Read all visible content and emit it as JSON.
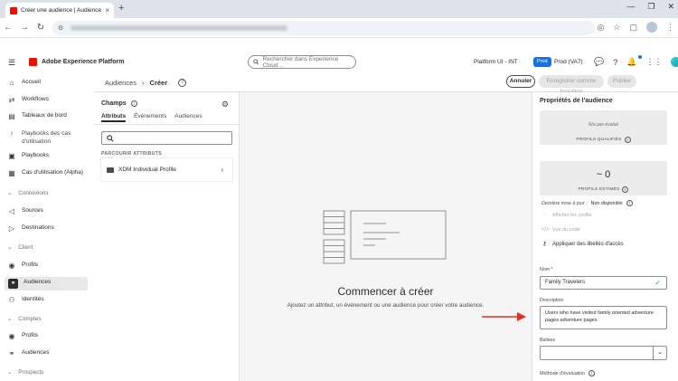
{
  "browser": {
    "tab_title": "Créer une audience | Audiences",
    "new_tab": "+",
    "window_controls": [
      "—",
      "❐",
      "✕"
    ]
  },
  "header": {
    "menu_icon": "hamburger-icon",
    "brand": "Adobe Experience Platform",
    "search_placeholder": "Rechercher dans Experience Cloud ...",
    "sandbox": "Platform UI - INT",
    "prod_badge": "Prod",
    "prod_name": "Prod (VA7)"
  },
  "sidebar": {
    "items": [
      {
        "label": "Accueil",
        "icon": "home-icon"
      },
      {
        "label": "Workflows",
        "icon": "workflow-icon"
      },
      {
        "label": "Tableaux de bord",
        "icon": "dashboard-icon"
      },
      {
        "label": "Playbooks des cas d'utilisation",
        "icon": "chevron-icon"
      },
      {
        "label": "Playbooks",
        "icon": "playbook-icon"
      },
      {
        "label": "Cas d'utilisation (Alpha)",
        "icon": "usecase-icon"
      }
    ],
    "section_connections": "Connexions",
    "connections": [
      {
        "label": "Sources",
        "icon": "sources-icon"
      },
      {
        "label": "Destinations",
        "icon": "destinations-icon"
      }
    ],
    "section_client": "Client",
    "client": [
      {
        "label": "Profils",
        "icon": "profile-icon"
      },
      {
        "label": "Audiences",
        "icon": "audiences-icon"
      },
      {
        "label": "Identités",
        "icon": "identity-icon"
      }
    ],
    "section_accounts": "Comptes",
    "accounts": [
      {
        "label": "Profils",
        "icon": "profile-icon"
      },
      {
        "label": "Audiences",
        "icon": "audiences-icon"
      }
    ],
    "section_prospects": "Prospects"
  },
  "page": {
    "breadcrumb_parent": "Audiences",
    "breadcrumb_current": "Créer",
    "help": "?",
    "cancel": "Annuler",
    "save_draft": "Enregistrer comme brouillon",
    "publish": "Publier"
  },
  "fields": {
    "title": "Champs",
    "tabs": [
      "Attributs",
      "Événements",
      "Audiences"
    ],
    "browse_label": "PARCOURIR ATTRIBUTS",
    "tree_item": "XDM Individual Profile"
  },
  "canvas": {
    "title": "Commencer à créer",
    "subtitle": "Ajoutez un attribut, un événement ou une audience pour créer votre audience."
  },
  "properties": {
    "title": "Propriétés de l'audience",
    "not_evaluated": "N/a pas évalué",
    "qualified_label": "PROFILS QUALIFIÉS",
    "estimate_value": "~ 0",
    "estimated_label": "PROFILS ESTIMÉS",
    "last_update_label": "Dernière mise à jour :",
    "last_update_value": "Non disponible",
    "view_profiles": "Afficher les profils",
    "view_code": "Vue du code",
    "apply_labels": "Appliquer des libellés d'accès",
    "name_label": "Nom",
    "required_mark": "*",
    "name_value": "Family Travelers",
    "desc_label": "Description",
    "desc_value": "Users who have visited family oriented adventure pages adventure pages",
    "tags_label": "Balises",
    "method_label": "Méthode d'évaluation"
  },
  "colors": {
    "brand_red": "#eb1000",
    "prod_blue": "#1473e6",
    "valid_green": "#2d9d78",
    "arrow_red": "#e0321f"
  }
}
